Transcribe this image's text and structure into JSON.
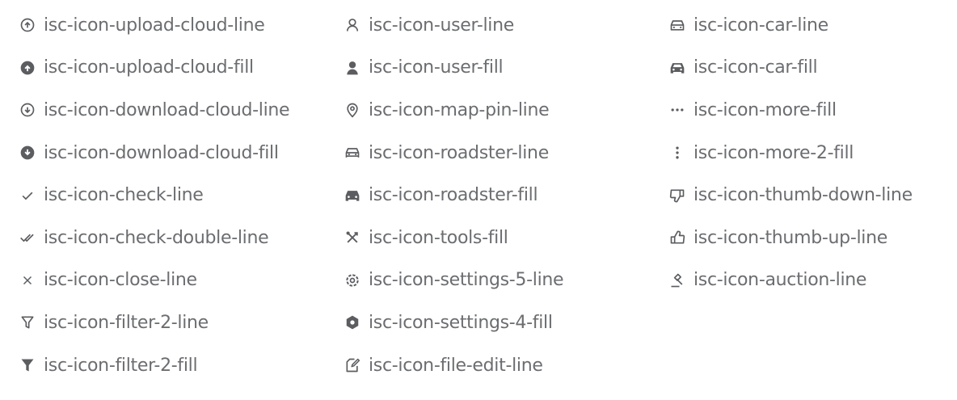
{
  "columns": [
    {
      "items": [
        {
          "icon": "upload-cloud-line-icon",
          "label": "isc-icon-upload-cloud-line"
        },
        {
          "icon": "upload-cloud-fill-icon",
          "label": "isc-icon-upload-cloud-fill"
        },
        {
          "icon": "download-cloud-line-icon",
          "label": "isc-icon-download-cloud-line"
        },
        {
          "icon": "download-cloud-fill-icon",
          "label": "isc-icon-download-cloud-fill"
        },
        {
          "icon": "check-line-icon",
          "label": "isc-icon-check-line"
        },
        {
          "icon": "check-double-line-icon",
          "label": "isc-icon-check-double-line"
        },
        {
          "icon": "close-line-icon",
          "label": "isc-icon-close-line"
        },
        {
          "icon": "filter-2-line-icon",
          "label": "isc-icon-filter-2-line"
        },
        {
          "icon": "filter-2-fill-icon",
          "label": "isc-icon-filter-2-fill"
        }
      ]
    },
    {
      "items": [
        {
          "icon": "user-line-icon",
          "label": "isc-icon-user-line"
        },
        {
          "icon": "user-fill-icon",
          "label": "isc-icon-user-fill"
        },
        {
          "icon": "map-pin-line-icon",
          "label": "isc-icon-map-pin-line"
        },
        {
          "icon": "roadster-line-icon",
          "label": "isc-icon-roadster-line"
        },
        {
          "icon": "roadster-fill-icon",
          "label": "isc-icon-roadster-fill"
        },
        {
          "icon": "tools-fill-icon",
          "label": "isc-icon-tools-fill"
        },
        {
          "icon": "settings-5-line-icon",
          "label": "isc-icon-settings-5-line"
        },
        {
          "icon": "settings-4-fill-icon",
          "label": "isc-icon-settings-4-fill"
        },
        {
          "icon": "file-edit-line-icon",
          "label": "isc-icon-file-edit-line"
        }
      ]
    },
    {
      "items": [
        {
          "icon": "car-line-icon",
          "label": "isc-icon-car-line"
        },
        {
          "icon": "car-fill-icon",
          "label": "isc-icon-car-fill"
        },
        {
          "icon": "more-fill-icon",
          "label": "isc-icon-more-fill"
        },
        {
          "icon": "more-2-fill-icon",
          "label": "isc-icon-more-2-fill"
        },
        {
          "icon": "thumb-down-line-icon",
          "label": "isc-icon-thumb-down-line"
        },
        {
          "icon": "thumb-up-line-icon",
          "label": "isc-icon-thumb-up-line"
        },
        {
          "icon": "auction-line-icon",
          "label": "isc-icon-auction-line"
        }
      ]
    }
  ],
  "colors": {
    "text": "#6b6d70",
    "icon": "#5b5d60",
    "background": "#ffffff"
  }
}
